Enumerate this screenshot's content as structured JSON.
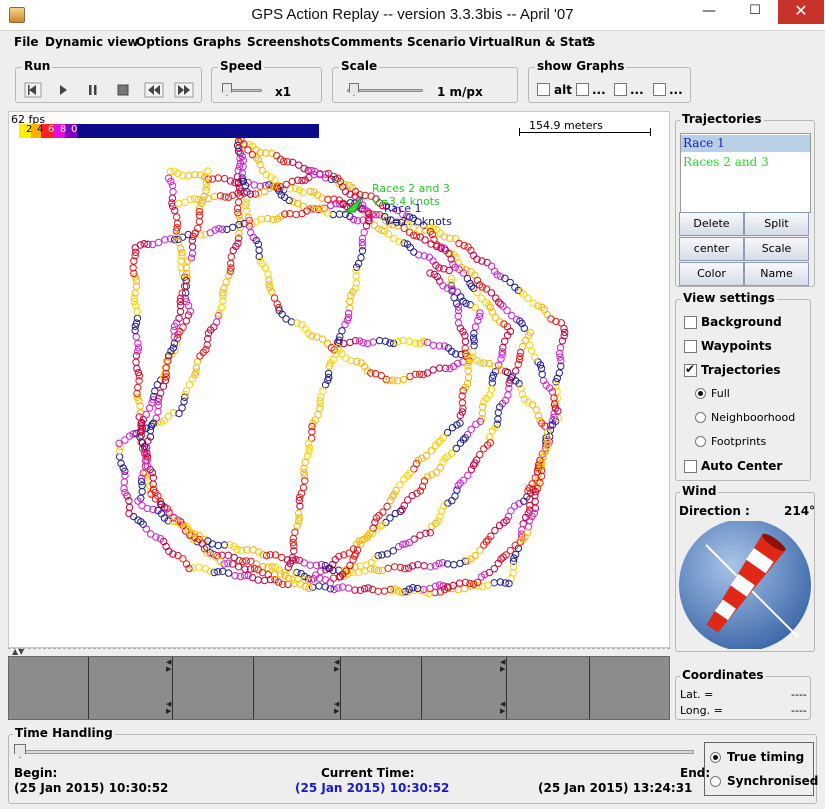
{
  "window": {
    "title": "GPS Action Replay -- version 3.3.3bis -- April '07",
    "minimize": "—",
    "maximize": "☐",
    "close": "✕"
  },
  "menu": [
    "File",
    "Dynamic view",
    "Options",
    "Graphs",
    "Screenshots",
    "Comments",
    "Scenario",
    "VirtualRun & Stats",
    "?"
  ],
  "toolbar": {
    "run": {
      "title": "Run",
      "buttons": [
        "rewind-icon",
        "play-icon",
        "pause-icon",
        "stop-icon",
        "skip-back-icon",
        "skip-forward-icon"
      ]
    },
    "speed": {
      "title": "Speed",
      "value": "x1",
      "level": 0.05
    },
    "scale": {
      "title": "Scale",
      "value": "1 m/px",
      "level": 0.05
    },
    "show_graphs": {
      "title": "show Graphs",
      "options": [
        "alt",
        "...",
        "...",
        "..."
      ]
    }
  },
  "map": {
    "fps": "62 fps",
    "color_scale_labels": [
      "2",
      "4",
      "6",
      "8",
      "0"
    ],
    "scale_label": "154.9 meters",
    "labels": [
      {
        "line1": "Races 2 and 3",
        "line2": "V=3.4 knots",
        "color": "#22cc22"
      },
      {
        "line1": "Race 1",
        "line2": "V=2.7 knots",
        "color": "#1a1a8c"
      }
    ]
  },
  "trajectories": {
    "title": "Trajectories",
    "items": [
      {
        "label": "Race 1",
        "color": "#1a1acc",
        "selected": true
      },
      {
        "label": "Races 2 and 3",
        "color": "#22dd22",
        "selected": false
      }
    ],
    "buttons": [
      "Delete",
      "Split",
      "center",
      "Scale",
      "Color",
      "Name"
    ]
  },
  "view_settings": {
    "title": "View settings",
    "checkboxes": [
      {
        "label": "Background",
        "checked": false
      },
      {
        "label": "Waypoints",
        "checked": false
      },
      {
        "label": "Trajectories",
        "checked": true
      }
    ],
    "radios": [
      {
        "label": "Full",
        "on": true
      },
      {
        "label": "Neighboorhood",
        "on": false
      },
      {
        "label": "Footprints",
        "on": false
      }
    ],
    "auto_center": {
      "label": "Auto Center",
      "checked": false
    }
  },
  "wind": {
    "title": "Wind",
    "direction_label": "Direction :",
    "direction_value": "214°"
  },
  "coordinates": {
    "title": "Coordinates",
    "lat_label": "Lat. =",
    "lat_value": "----",
    "long_label": "Long. =",
    "long_value": "----"
  },
  "time_handling": {
    "title": "Time Handling",
    "begin_label": "Begin:",
    "begin_value": "(25 Jan 2015) 10:30:52",
    "current_label": "Current Time:",
    "current_value": "(25 Jan 2015) 10:30:52",
    "end_label": "End:",
    "end_value": "(25 Jan 2015) 13:24:31",
    "position": 0,
    "mode_options": [
      {
        "label": "True timing",
        "on": true
      },
      {
        "label": "Synchronised",
        "on": false
      }
    ]
  }
}
